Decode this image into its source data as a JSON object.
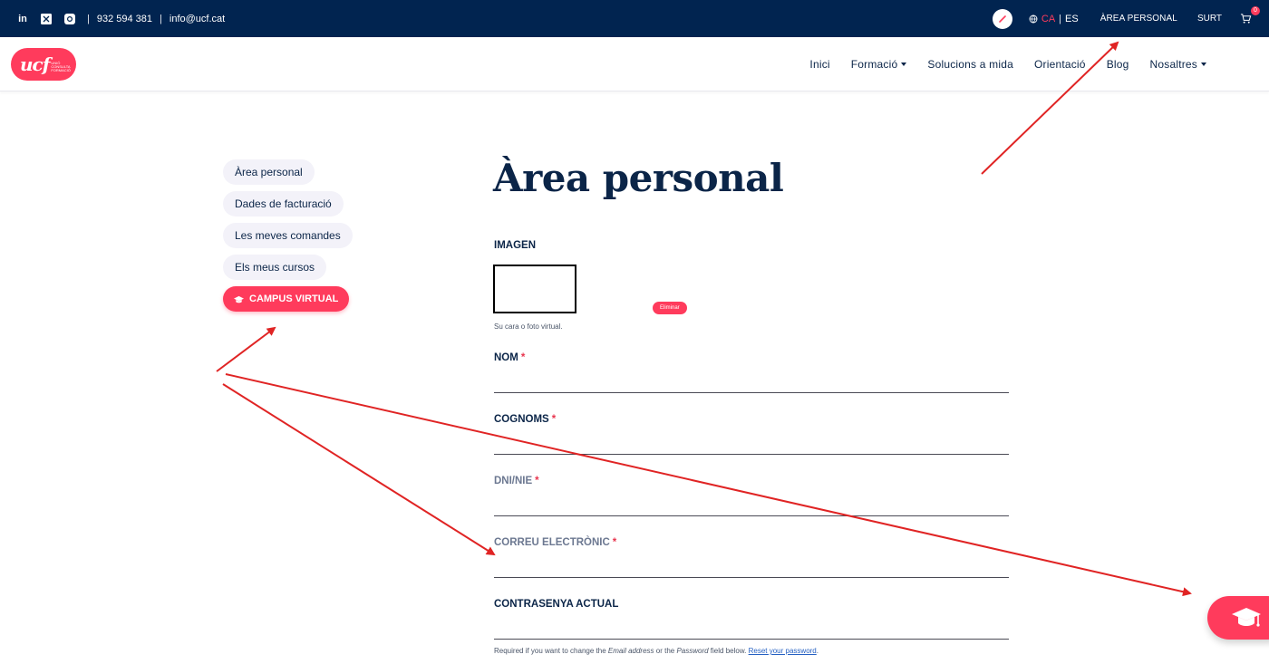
{
  "topbar": {
    "social": [
      "linkedin-icon",
      "x-icon",
      "instagram-icon"
    ],
    "phone": "932 594 381",
    "email": "info@ucf.cat",
    "lang_active": "CA",
    "lang_other": "ES",
    "area_label": "ÀREA PERSONAL",
    "logout_label": "SURT",
    "cart_count": "0"
  },
  "logo": {
    "main": "ucf",
    "sub": "UNIÓ CONSULTA FORMACIÓ"
  },
  "nav": {
    "items": [
      {
        "label": "Inici"
      },
      {
        "label": "Formació"
      },
      {
        "label": "Solucions a mida"
      },
      {
        "label": "Orientació"
      },
      {
        "label": "Blog"
      },
      {
        "label": "Nosaltres"
      }
    ]
  },
  "sidebar": {
    "items": [
      {
        "label": "Àrea personal"
      },
      {
        "label": "Dades de facturació"
      },
      {
        "label": "Les meves comandes"
      },
      {
        "label": "Els meus cursos"
      },
      {
        "label": "CAMPUS VIRTUAL"
      }
    ]
  },
  "main": {
    "title": "Àrea personal",
    "image_label": "IMAGEN",
    "image_remove": "Eliminar",
    "image_help": "Su cara o foto virtual.",
    "fields": [
      {
        "label": "NOM",
        "required": "*"
      },
      {
        "label": "COGNOMS",
        "required": "*"
      },
      {
        "label": "DNI/NIE",
        "required": "*"
      },
      {
        "label": "CORREU ELECTRÒNIC",
        "required": "*"
      },
      {
        "label": "CONTRASENYA ACTUAL",
        "required": ""
      }
    ],
    "pw_help_1": "Required if you want to change the ",
    "pw_help_em1": "Email address",
    "pw_help_2": " or the ",
    "pw_help_em2": "Password",
    "pw_help_3": " field below. ",
    "pw_help_link": "Reset your password",
    "pw_help_4": "."
  },
  "colors": {
    "navy": "#012450",
    "accent": "#ff3b5c",
    "annotation": "#e02424"
  }
}
